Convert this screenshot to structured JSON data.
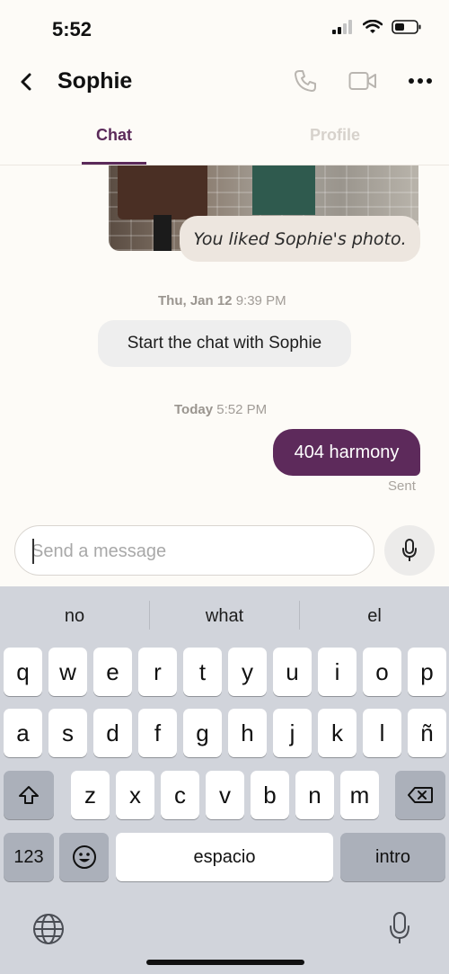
{
  "status_bar": {
    "time": "5:52"
  },
  "header": {
    "contact_name": "Sophie"
  },
  "tabs": [
    {
      "label": "Chat"
    },
    {
      "label": "Profile"
    }
  ],
  "messages": {
    "liked_photo_text": "You liked Sophie's photo.",
    "timestamp1_day": "Thu, Jan 12",
    "timestamp1_time": "9:39 PM",
    "system_prompt": "Start the chat with Sophie",
    "timestamp2_day": "Today",
    "timestamp2_time": "5:52 PM",
    "sent_text": "404 harmony",
    "sent_status": "Sent"
  },
  "composer": {
    "placeholder": "Send a message",
    "value": ""
  },
  "keyboard": {
    "suggestions": [
      "no",
      "what",
      "el"
    ],
    "row1": [
      "q",
      "w",
      "e",
      "r",
      "t",
      "y",
      "u",
      "i",
      "o",
      "p"
    ],
    "row2": [
      "a",
      "s",
      "d",
      "f",
      "g",
      "h",
      "j",
      "k",
      "l",
      "ñ"
    ],
    "row3": [
      "z",
      "x",
      "c",
      "v",
      "b",
      "n",
      "m"
    ],
    "numbers_label": "123",
    "space_label": "espacio",
    "return_label": "intro"
  },
  "colors": {
    "accent": "#5d2a5b",
    "tab_inactive": "#d7d2cc",
    "keyboard_bg": "#d1d4db"
  },
  "icons": [
    "back-chevron-icon",
    "phone-icon",
    "video-icon",
    "more-icon",
    "microphone-icon",
    "shift-icon",
    "backspace-icon",
    "emoji-icon",
    "globe-icon",
    "dictation-icon"
  ]
}
